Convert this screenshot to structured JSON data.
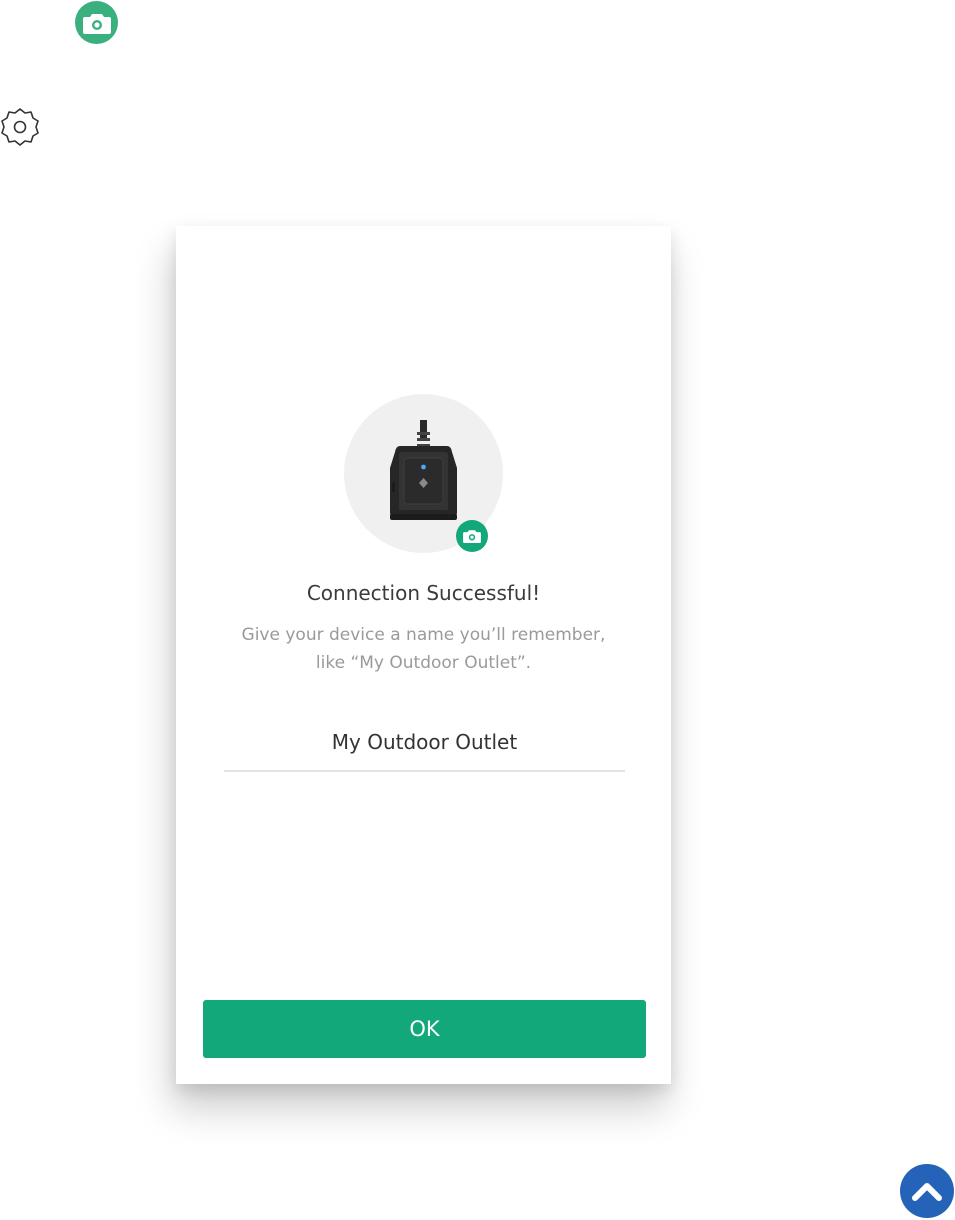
{
  "icons": {
    "top_camera": "camera-icon",
    "settings": "gear-icon",
    "device_camera": "camera-icon",
    "scroll_top": "chevron-up-icon"
  },
  "dialog": {
    "title": "Connection Successful!",
    "description_line1": "Give your device a name you’ll remember,",
    "description_line2": "like “My Outdoor Outlet”.",
    "device_name_value": "My Outdoor Outlet",
    "ok_label": "OK"
  },
  "colors": {
    "accent_green": "#13a87a",
    "top_camera_green": "#3bb07f",
    "scroll_button_blue": "#2563b8",
    "device_circle_bg": "#f0f0f0"
  }
}
